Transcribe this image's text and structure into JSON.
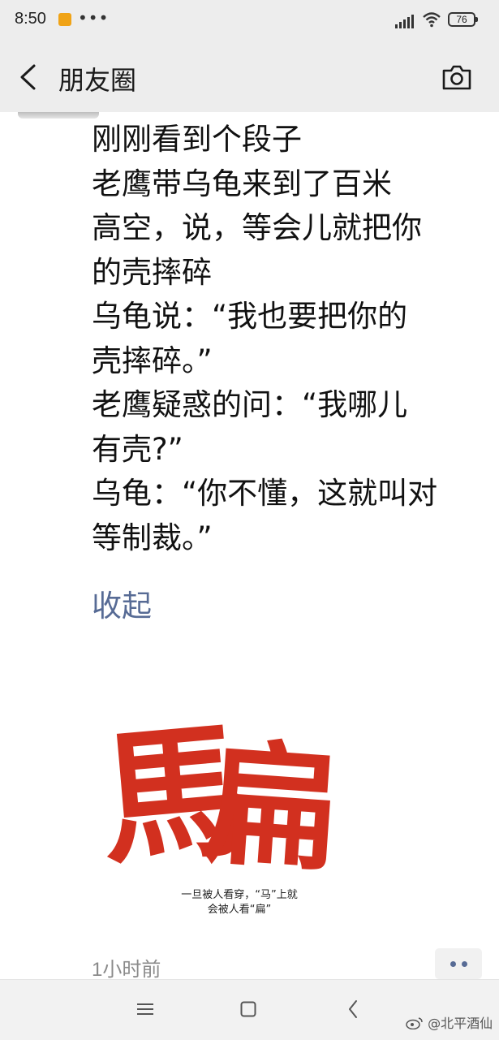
{
  "status_bar": {
    "time": "8:50",
    "dots": "•••",
    "battery": "76"
  },
  "nav": {
    "title": "朋友圈"
  },
  "post": {
    "lines": [
      "刚刚看到个段子",
      "老鹰带乌龟来到了百米",
      "高空，说，等会儿就把你",
      "的壳摔碎",
      "乌龟说：“我也要把你的",
      "壳摔碎。”",
      "老鹰疑惑的问：“我哪儿",
      "有壳?”",
      "乌龟：“你不懂，这就叫对",
      "等制裁。”"
    ],
    "collapse_label": "收起",
    "image": {
      "glyph_left": "馬",
      "glyph_right": "扁",
      "caption_line1": "一旦被人看穿，“马”上就",
      "caption_line2": "会被人看“扁”",
      "color": "#d2301f"
    },
    "time": "1小时前"
  },
  "watermark": "@北平酒仙",
  "icons": {
    "back": "chevron-left-icon",
    "camera": "camera-icon",
    "more": "more-dots-icon",
    "menu": "menu-icon",
    "home": "home-icon",
    "system_back": "back-icon"
  },
  "colors": {
    "link": "#576b95",
    "header_bg": "#ededed",
    "time_text": "#8a8a8a"
  }
}
